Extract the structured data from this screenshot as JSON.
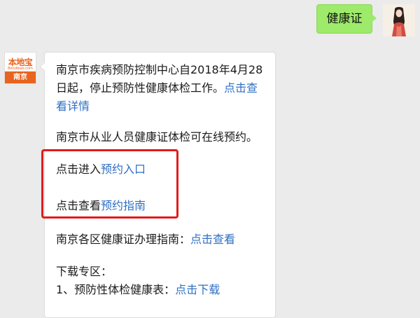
{
  "user_message": {
    "text": "健康证"
  },
  "account": {
    "logo_text": "本地宝",
    "logo_sub": "Bendibao.com",
    "city": "南京",
    "brand_color": "#e8641f"
  },
  "reply": {
    "para1_line1": "南京市疾病预防控制中心自2018年4月28",
    "para1_line2_text": "日起，停止预防性健康体检工作。",
    "para1_line2_link": "点击查",
    "para1_line3_link": "看详情",
    "para2": "南京市从业人员健康证体检可在线预约。",
    "entry_prefix": "点击进入",
    "entry_link": "预约入口",
    "guide_prefix": "点击查看",
    "guide_link": "预约指南",
    "district_prefix": "南京各区健康证办理指南：",
    "district_link": "点击查看",
    "download_heading": "下载专区：",
    "download_item_prefix": "1、预防性体检健康表：",
    "download_item_link": "点击下载"
  },
  "colors": {
    "link": "#2f6fc4",
    "user_bubble": "#9eea6a",
    "highlight_border": "#e21c1c",
    "background": "#ebebeb"
  }
}
